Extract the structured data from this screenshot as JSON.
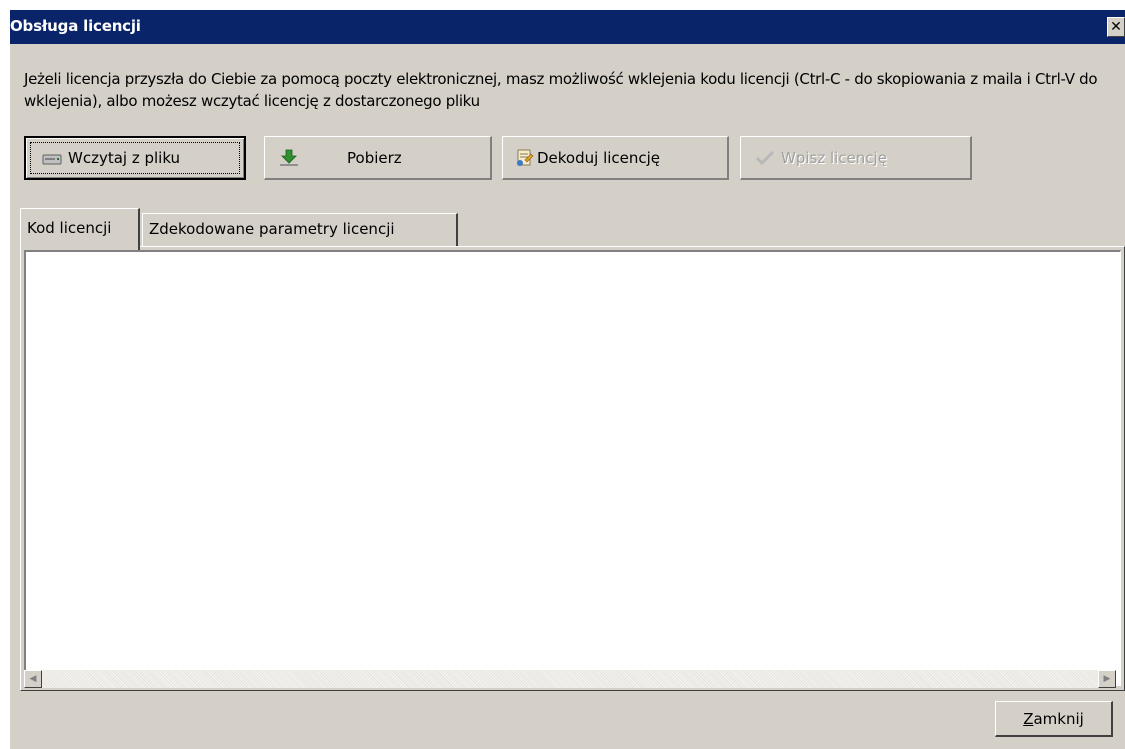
{
  "window": {
    "title": "Obsługa licencji",
    "close_glyph": "✕"
  },
  "description": "Jeżeli licencja przyszła do Ciebie za pomocą poczty elektronicznej, masz możliwość wklejenia kodu licencji (Ctrl-C - do skopiowania z maila i Ctrl-V do wklejenia), albo możesz wczytać licencję z dostarczonego pliku",
  "toolbar": {
    "load_file": {
      "label": "Wczytaj z pliku",
      "icon": "drive-icon"
    },
    "download": {
      "label": "Pobierz",
      "icon": "download-arrow-icon"
    },
    "decode": {
      "label": "Dekoduj licencję",
      "icon": "decode-license-icon"
    },
    "apply": {
      "label": "Wpisz licencję",
      "icon": "checkmark-icon",
      "disabled": true
    }
  },
  "tabs": [
    {
      "label": "Kod licencji",
      "active": true
    },
    {
      "label": "Zdekodowane parametry licencji",
      "active": false
    }
  ],
  "license_code": {
    "value": ""
  },
  "scrollbar": {
    "left": "◀",
    "right": "▶"
  },
  "footer": {
    "close_mnemonic": "Z",
    "close_rest": "amknij"
  },
  "colors": {
    "titlebar": "#0a246a",
    "face": "#d4d0c8"
  }
}
